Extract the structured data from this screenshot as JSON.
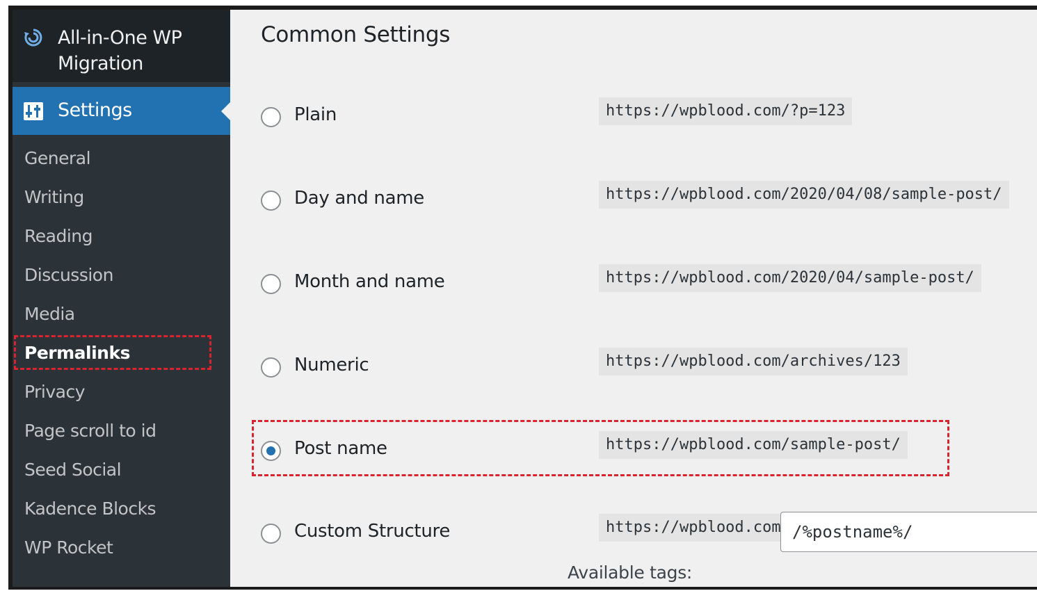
{
  "sidebar": {
    "plugin_label": "All-in-One WP Migration",
    "settings_label": "Settings",
    "items": [
      {
        "label": "General"
      },
      {
        "label": "Writing"
      },
      {
        "label": "Reading"
      },
      {
        "label": "Discussion"
      },
      {
        "label": "Media"
      },
      {
        "label": "Permalinks",
        "active": true
      },
      {
        "label": "Privacy"
      },
      {
        "label": "Page scroll to id"
      },
      {
        "label": "Seed Social"
      },
      {
        "label": "Kadence Blocks"
      },
      {
        "label": "WP Rocket"
      }
    ]
  },
  "main": {
    "heading": "Common Settings",
    "options": [
      {
        "label": "Plain",
        "url": "https://wpblood.com/?p=123",
        "checked": false
      },
      {
        "label": "Day and name",
        "url": "https://wpblood.com/2020/04/08/sample-post/",
        "checked": false
      },
      {
        "label": "Month and name",
        "url": "https://wpblood.com/2020/04/sample-post/",
        "checked": false
      },
      {
        "label": "Numeric",
        "url": "https://wpblood.com/archives/123",
        "checked": false
      },
      {
        "label": "Post name",
        "url": "https://wpblood.com/sample-post/",
        "checked": true
      },
      {
        "label": "Custom Structure",
        "url": "https://wpblood.com",
        "checked": false
      }
    ],
    "custom_structure_value": "/%postname%/",
    "available_tags_label": "Available tags:"
  },
  "colors": {
    "sidebar_bg": "#2c3338",
    "active_menu": "#2271b1",
    "highlight_dash": "#d9232e",
    "content_bg": "#f0f0f1"
  }
}
